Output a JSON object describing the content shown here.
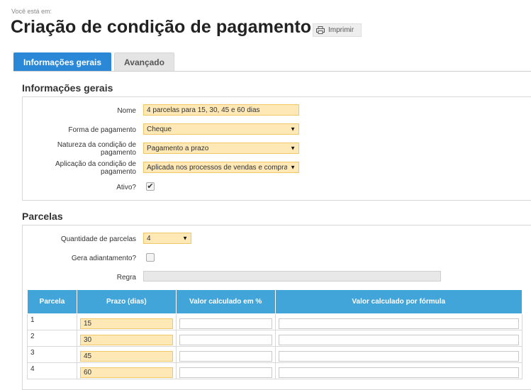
{
  "header": {
    "breadcrumb_label": "Você está em:",
    "title": "Criação de condição de pagamento",
    "print_label": "Imprimir"
  },
  "tabs": [
    {
      "label": "Informações gerais",
      "active": true
    },
    {
      "label": "Avançado",
      "active": false
    }
  ],
  "general": {
    "section_title": "Informações gerais",
    "name_label": "Nome",
    "name_value": "4 parcelas para 15, 30, 45 e 60 dias",
    "payment_method_label": "Forma de pagamento",
    "payment_method_value": "Cheque",
    "nature_label": "Natureza da condição de pagamento",
    "nature_value": "Pagamento a prazo",
    "application_label": "Aplicação da condição de pagamento",
    "application_value": "Aplicada nos processos de vendas e compras",
    "active_label": "Ativo?",
    "active_checked": true
  },
  "parcelas": {
    "section_title": "Parcelas",
    "quantity_label": "Quantidade de parcelas",
    "quantity_value": "4",
    "advance_label": "Gera adiantamento?",
    "advance_checked": false,
    "rule_label": "Regra",
    "rule_value": "",
    "columns": [
      "Parcela",
      "Prazo (dias)",
      "Valor calculado em %",
      "Valor calculado por fórmula"
    ],
    "rows": [
      {
        "number": "1",
        "prazo": "15",
        "percent": "",
        "formula": ""
      },
      {
        "number": "2",
        "prazo": "30",
        "percent": "",
        "formula": ""
      },
      {
        "number": "3",
        "prazo": "45",
        "percent": "",
        "formula": ""
      },
      {
        "number": "4",
        "prazo": "60",
        "percent": "",
        "formula": ""
      }
    ]
  },
  "colors": {
    "tab_active": "#2a88d6",
    "table_header": "#42a5d9",
    "input_highlight": "#fde8b6"
  }
}
